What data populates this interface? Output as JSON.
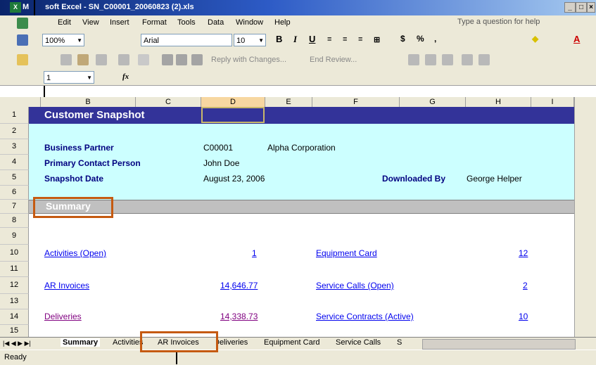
{
  "window": {
    "app_letters": "M",
    "title": "soft Excel - SN_C00001_20060823 (2).xls",
    "min_btn": "_",
    "max_btn": "□",
    "close_btn": "×"
  },
  "menu": {
    "items": [
      "Edit",
      "View",
      "Insert",
      "Format",
      "Tools",
      "Data",
      "Window",
      "Help"
    ],
    "ask_placeholder": "Type a question for help"
  },
  "format_toolbar": {
    "zoom": "100%",
    "font": "Arial",
    "size": "10",
    "bold": "B",
    "italic": "I",
    "underline": "U",
    "currency": "$",
    "percent": "%",
    "comma": ","
  },
  "reviewing_toolbar": {
    "reply_label": "Reply with Changes...",
    "end_review_label": "End Review..."
  },
  "formula_bar": {
    "name_box": "1",
    "fx": "fx",
    "value": ""
  },
  "columns": [
    "B",
    "C",
    "D",
    "E",
    "F",
    "G",
    "H",
    "I"
  ],
  "rows": [
    "1",
    "2",
    "3",
    "4",
    "5",
    "6",
    "7",
    "8",
    "9",
    "10",
    "11",
    "12",
    "13",
    "14",
    "15"
  ],
  "sheet": {
    "title": "Customer Snapshot",
    "business_partner_label": "Business Partner",
    "business_partner_id": "C00001",
    "business_partner_name": "Alpha Corporation",
    "contact_label": "Primary Contact Person",
    "contact_value": "John Doe",
    "snapshot_date_label": "Snapshot Date",
    "snapshot_date_value": "August 23, 2006",
    "downloaded_by_label": "Downloaded By",
    "downloaded_by_value": "George Helper",
    "summary_label": "Summary",
    "links_left": [
      {
        "label": "Activities (Open)",
        "value": "1"
      },
      {
        "label": "AR Invoices",
        "value": "14,646.77"
      },
      {
        "label": "Deliveries",
        "value": "14,338.73"
      }
    ],
    "links_right": [
      {
        "label": "Equipment Card",
        "value": "12"
      },
      {
        "label": "Service Calls (Open)",
        "value": "2"
      },
      {
        "label": "Service Contracts (Active)",
        "value": "10"
      }
    ]
  },
  "tabs": [
    "Summary",
    "Activities",
    "AR Invoices",
    "Deliveries",
    "Equipment Card",
    "Service Calls",
    "S"
  ],
  "status": {
    "text": "Ready"
  },
  "colors": {
    "title_band": "#333399",
    "info_band": "#ccffff",
    "summary_band": "#c0c0c0",
    "highlight": "#c55a11"
  }
}
